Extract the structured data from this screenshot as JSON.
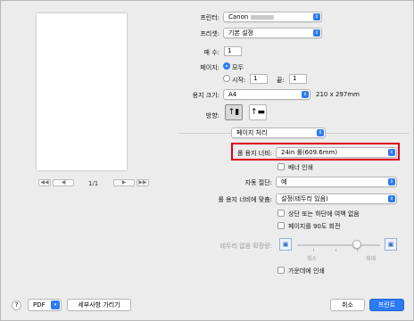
{
  "preview": {
    "page_indicator": "1/1",
    "first_btn": "◀◀",
    "prev_btn": "◀",
    "next_btn": "▶",
    "last_btn": "▶▶"
  },
  "printer": {
    "label": "프린터:",
    "value": "Canon"
  },
  "preset": {
    "label": "프리셋:",
    "value": "기본 설정"
  },
  "copies": {
    "label": "매 수:",
    "value": "1"
  },
  "pages": {
    "label": "페이지:",
    "all_label": "모두",
    "from_label": "시작:",
    "from_value": "1",
    "to_label": "끝:",
    "to_value": "1"
  },
  "paper_size": {
    "label": "용지 크기:",
    "value": "A4",
    "dimensions": "210 x 297mm"
  },
  "orientation": {
    "label": "방향:"
  },
  "section_menu": {
    "value": "페이지 처리"
  },
  "roll_width": {
    "label": "롤 용지 너비:",
    "value": "24in 롤(609.6mm)"
  },
  "banner_print": {
    "label": "배너 인쇄"
  },
  "auto_cut": {
    "label": "자동 절단:",
    "value": "예"
  },
  "fit_roll": {
    "label": "롤 용지 너비에 맞춤:",
    "value": "설정(테두리 있음)"
  },
  "no_margin_top_bottom": {
    "label": "상단 또는 하단에 여백 없음"
  },
  "rotate_90": {
    "label": "페이지를 90도 회전"
  },
  "borderless_ext": {
    "label": "테두리 없음 확장량:",
    "min_label": "최소",
    "max_label": "최대",
    "level": 0.66
  },
  "print_center": {
    "label": "가운데에 인쇄"
  },
  "footer": {
    "help": "?",
    "pdf": "PDF",
    "hide_details": "세부사항 가리기",
    "cancel": "취소",
    "print": "프린트"
  },
  "colors": {
    "accent": "#2d7bf4",
    "highlight": "#e0001a"
  }
}
